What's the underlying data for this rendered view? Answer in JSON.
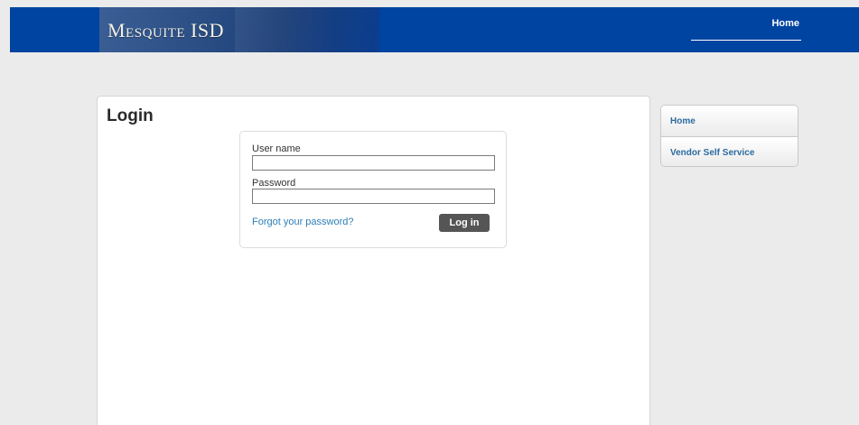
{
  "header": {
    "logo_text": "Mesquite ISD",
    "nav": {
      "home_label": "Home"
    }
  },
  "main": {
    "title": "Login",
    "form": {
      "username_label": "User name",
      "username_value": "",
      "password_label": "Password",
      "password_value": "",
      "forgot_link": "Forgot your password?",
      "login_button": "Log in"
    }
  },
  "sidebar": {
    "items": [
      {
        "label": "Home"
      },
      {
        "label": "Vendor Self Service"
      }
    ]
  },
  "colors": {
    "header_blue": "#0044a1",
    "link_blue": "#2c7fb8",
    "button_gray": "#555555",
    "page_background": "#ebebeb"
  }
}
